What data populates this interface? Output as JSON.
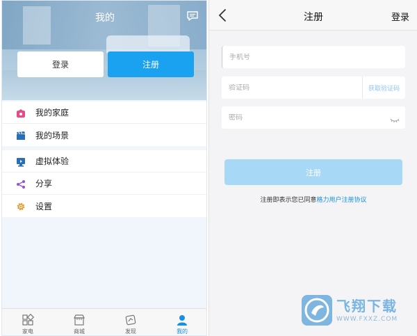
{
  "left": {
    "title": "我的",
    "login_label": "登录",
    "register_label": "注册",
    "menu": [
      {
        "label": "我的家庭",
        "icon": "home-icon",
        "color": "#e44d8a"
      },
      {
        "label": "我的场景",
        "icon": "clapper-icon",
        "color": "#2b6fb8"
      },
      {
        "label": "虚拟体验",
        "icon": "virtual-icon",
        "color": "#2b6fb8"
      },
      {
        "label": "分享",
        "icon": "share-icon",
        "color": "#9a4fd6"
      },
      {
        "label": "设置",
        "icon": "gear-icon",
        "color": "#e39a2a"
      }
    ],
    "tabs": [
      {
        "label": "家电",
        "icon": "appliance-icon"
      },
      {
        "label": "商城",
        "icon": "store-icon"
      },
      {
        "label": "发现",
        "icon": "discover-icon"
      },
      {
        "label": "我的",
        "icon": "user-icon",
        "active": true
      }
    ]
  },
  "right": {
    "title": "注册",
    "login_label": "登录",
    "phone_placeholder": "手机号",
    "code_placeholder": "验证码",
    "get_code_label": "获取验证码",
    "password_placeholder": "密码",
    "register_label": "注册",
    "agree_text": "注册即表示您已同意",
    "agree_link": "格力用户注册协议"
  },
  "watermark": {
    "name": "飞翔下载",
    "url": "WWW.FXXZ.COM"
  },
  "colors": {
    "accent": "#1aa2f0",
    "accent_disabled": "#a7d9f6",
    "link": "#1a8fe0"
  }
}
